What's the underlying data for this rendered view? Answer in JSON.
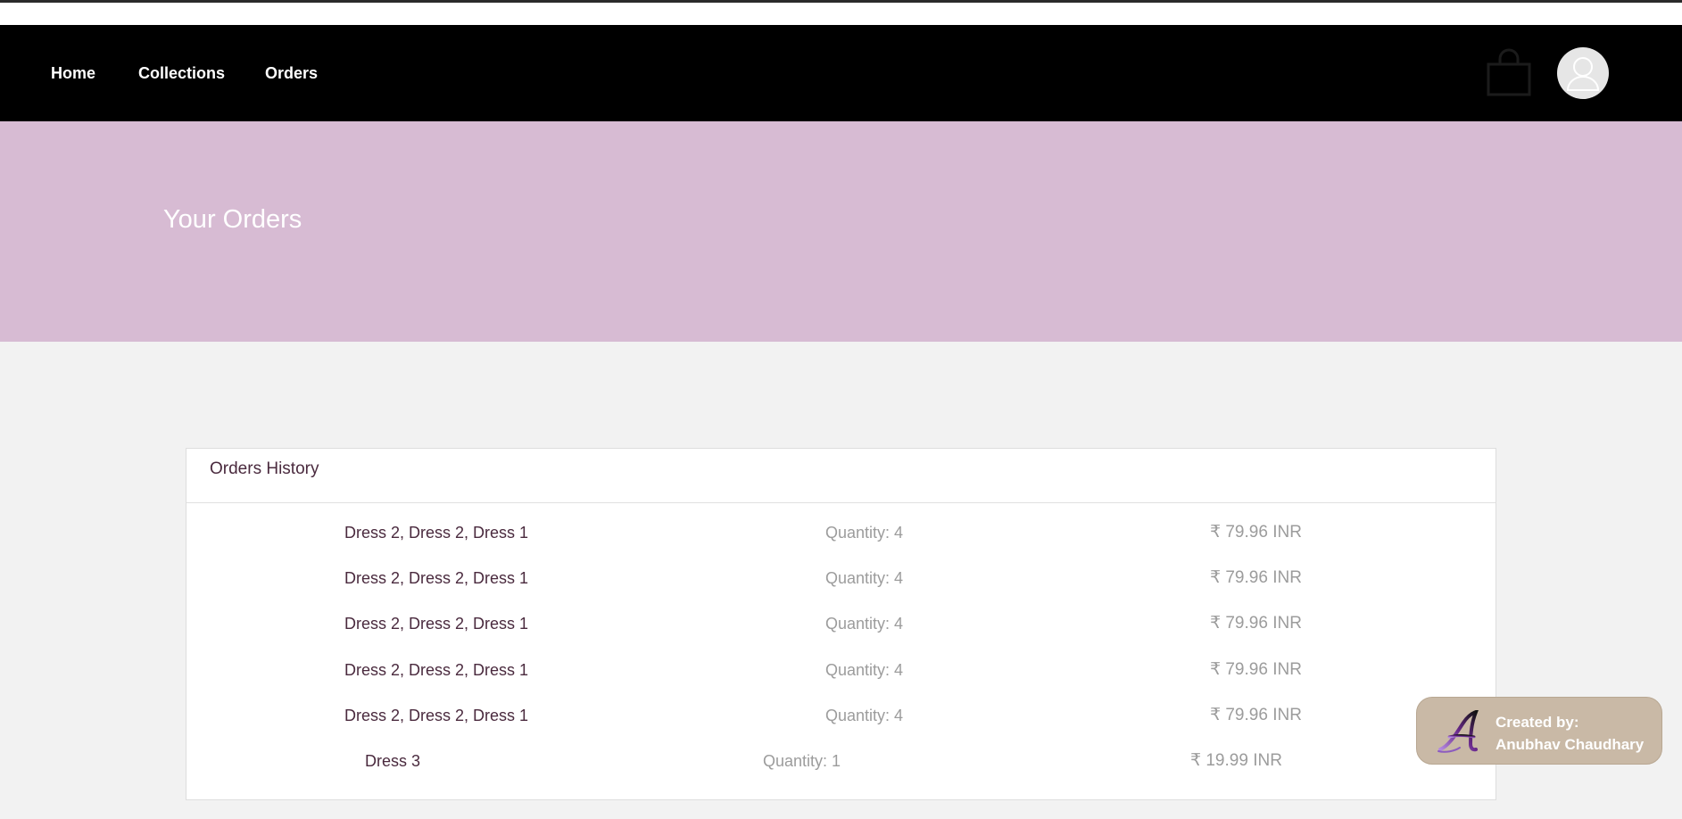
{
  "nav": {
    "links": [
      "Home",
      "Collections",
      "Orders"
    ]
  },
  "icons": {
    "cart": "shopping-bag-icon",
    "avatar": "user-avatar-icon",
    "credit_logo": "letter-a-logo"
  },
  "hero": {
    "title": "Your Orders"
  },
  "orders": {
    "title": "Orders History",
    "rows": [
      {
        "items": "Dress 2, Dress 2, Dress 1",
        "quantity": "Quantity: 4",
        "price": "₹ 79.96 INR"
      },
      {
        "items": "Dress 2, Dress 2, Dress 1",
        "quantity": "Quantity: 4",
        "price": "₹ 79.96 INR"
      },
      {
        "items": "Dress 2, Dress 2, Dress 1",
        "quantity": "Quantity: 4",
        "price": "₹ 79.96 INR"
      },
      {
        "items": "Dress 2, Dress 2, Dress 1",
        "quantity": "Quantity: 4",
        "price": "₹ 79.96 INR"
      },
      {
        "items": "Dress 2, Dress 2, Dress 1",
        "quantity": "Quantity: 4",
        "price": "₹ 79.96 INR"
      },
      {
        "items": "Dress 3",
        "quantity": "Quantity: 1",
        "price": "₹ 19.99 INR"
      }
    ]
  },
  "credit": {
    "line1": "Created by:",
    "line2": "Anubhav Chaudhary"
  },
  "colors": {
    "navbar": "#000000",
    "hero": "#d7bbd3",
    "page_bg": "#f2f2f2",
    "item_text": "#4a2a3e",
    "muted_text": "#9c9c9c",
    "credit_bg": "#c9b9a6"
  }
}
